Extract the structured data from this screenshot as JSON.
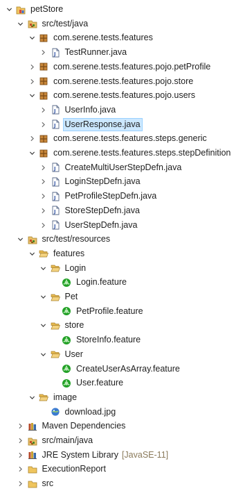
{
  "tree": [
    {
      "label": "petStore",
      "indent": 0,
      "arrow": "down",
      "icon": "project-icon"
    },
    {
      "label": "src/test/java",
      "indent": 1,
      "arrow": "down",
      "icon": "source-folder-icon"
    },
    {
      "label": "com.serene.tests.features",
      "indent": 2,
      "arrow": "down",
      "icon": "package-icon"
    },
    {
      "label": "TestRunner.java",
      "indent": 3,
      "arrow": "right",
      "icon": "java-file-icon"
    },
    {
      "label": "com.serene.tests.features.pojo.petProfile",
      "indent": 2,
      "arrow": "right",
      "icon": "package-icon"
    },
    {
      "label": "com.serene.tests.features.pojo.store",
      "indent": 2,
      "arrow": "right",
      "icon": "package-icon"
    },
    {
      "label": "com.serene.tests.features.pojo.users",
      "indent": 2,
      "arrow": "down",
      "icon": "package-icon"
    },
    {
      "label": "UserInfo.java",
      "indent": 3,
      "arrow": "right",
      "icon": "java-file-icon"
    },
    {
      "label": "UserResponse.java",
      "indent": 3,
      "arrow": "right",
      "icon": "java-file-icon",
      "selected": true
    },
    {
      "label": "com.serene.tests.features.steps.generic",
      "indent": 2,
      "arrow": "right",
      "icon": "package-icon"
    },
    {
      "label": "com.serene.tests.features.steps.stepDefinition",
      "indent": 2,
      "arrow": "down",
      "icon": "package-icon"
    },
    {
      "label": "CreateMultiUserStepDefn.java",
      "indent": 3,
      "arrow": "right",
      "icon": "java-file-icon"
    },
    {
      "label": "LoginStepDefn.java",
      "indent": 3,
      "arrow": "right",
      "icon": "java-file-icon"
    },
    {
      "label": "PetProfileStepDefn.java",
      "indent": 3,
      "arrow": "right",
      "icon": "java-file-icon"
    },
    {
      "label": "StoreStepDefn.java",
      "indent": 3,
      "arrow": "right",
      "icon": "java-file-icon"
    },
    {
      "label": "UserStepDefn.java",
      "indent": 3,
      "arrow": "right",
      "icon": "java-file-icon"
    },
    {
      "label": "src/test/resources",
      "indent": 1,
      "arrow": "down",
      "icon": "source-folder-icon"
    },
    {
      "label": "features",
      "indent": 2,
      "arrow": "down",
      "icon": "open-folder-icon"
    },
    {
      "label": "Login",
      "indent": 3,
      "arrow": "down",
      "icon": "open-folder-icon"
    },
    {
      "label": "Login.feature",
      "indent": 4,
      "arrow": "none",
      "icon": "cucumber-feature-icon"
    },
    {
      "label": "Pet",
      "indent": 3,
      "arrow": "down",
      "icon": "open-folder-icon"
    },
    {
      "label": "PetProfile.feature",
      "indent": 4,
      "arrow": "none",
      "icon": "cucumber-feature-icon"
    },
    {
      "label": "store",
      "indent": 3,
      "arrow": "down",
      "icon": "open-folder-icon"
    },
    {
      "label": "StoreInfo.feature",
      "indent": 4,
      "arrow": "none",
      "icon": "cucumber-feature-icon"
    },
    {
      "label": "User",
      "indent": 3,
      "arrow": "down",
      "icon": "open-folder-icon"
    },
    {
      "label": "CreateUserAsArray.feature",
      "indent": 4,
      "arrow": "none",
      "icon": "cucumber-feature-icon"
    },
    {
      "label": "User.feature",
      "indent": 4,
      "arrow": "none",
      "icon": "cucumber-feature-icon"
    },
    {
      "label": "image",
      "indent": 2,
      "arrow": "down",
      "icon": "open-folder-icon"
    },
    {
      "label": "download.jpg",
      "indent": 3,
      "arrow": "none",
      "icon": "image-file-icon"
    },
    {
      "label": "Maven Dependencies",
      "indent": 1,
      "arrow": "right",
      "icon": "library-icon"
    },
    {
      "label": "src/main/java",
      "indent": 1,
      "arrow": "right",
      "icon": "source-folder-icon"
    },
    {
      "label": "JRE System Library",
      "indent": 1,
      "arrow": "right",
      "icon": "library-icon",
      "extra": "[JavaSE-11]"
    },
    {
      "label": "ExecutionReport",
      "indent": 1,
      "arrow": "right",
      "icon": "closed-folder-icon"
    },
    {
      "label": "src",
      "indent": 1,
      "arrow": "right",
      "icon": "closed-folder-icon"
    }
  ]
}
